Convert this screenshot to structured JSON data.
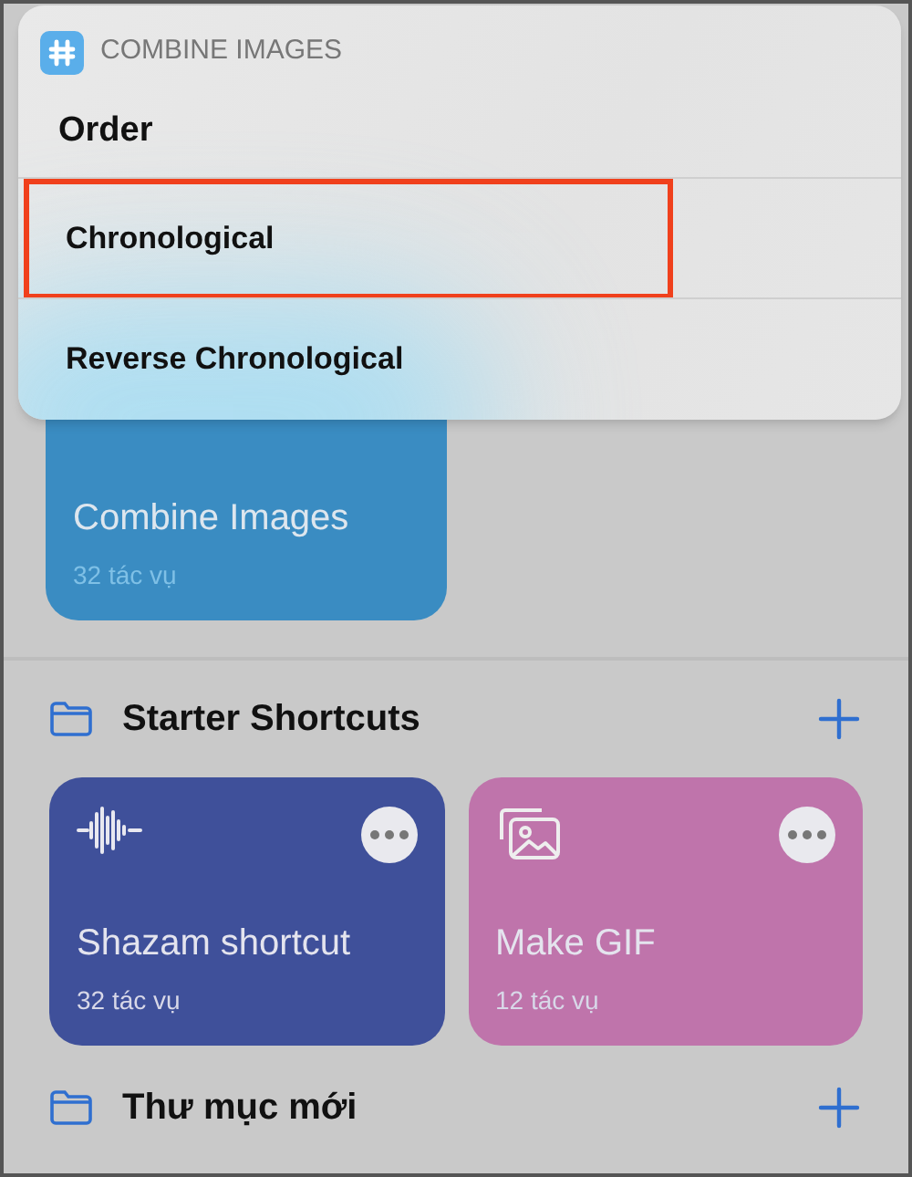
{
  "menu": {
    "app_title": "COMBINE IMAGES",
    "title": "Order",
    "options": [
      {
        "label": "Chronological",
        "highlighted": true
      },
      {
        "label": "Reverse Chronological",
        "highlighted": false
      }
    ]
  },
  "top_card": {
    "name": "Combine Images",
    "count": "32 tác vụ",
    "color": "#3a8cc2"
  },
  "folders": [
    {
      "name": "Starter Shortcuts",
      "cards": [
        {
          "name": "Shazam shortcut",
          "count": "32 tác vụ",
          "color": "#3f509a",
          "kind": "waveform"
        },
        {
          "name": "Make GIF",
          "count": "12 tác vụ",
          "color": "#bf74ab",
          "kind": "photos"
        }
      ]
    },
    {
      "name": "Thư mục mới"
    }
  ]
}
